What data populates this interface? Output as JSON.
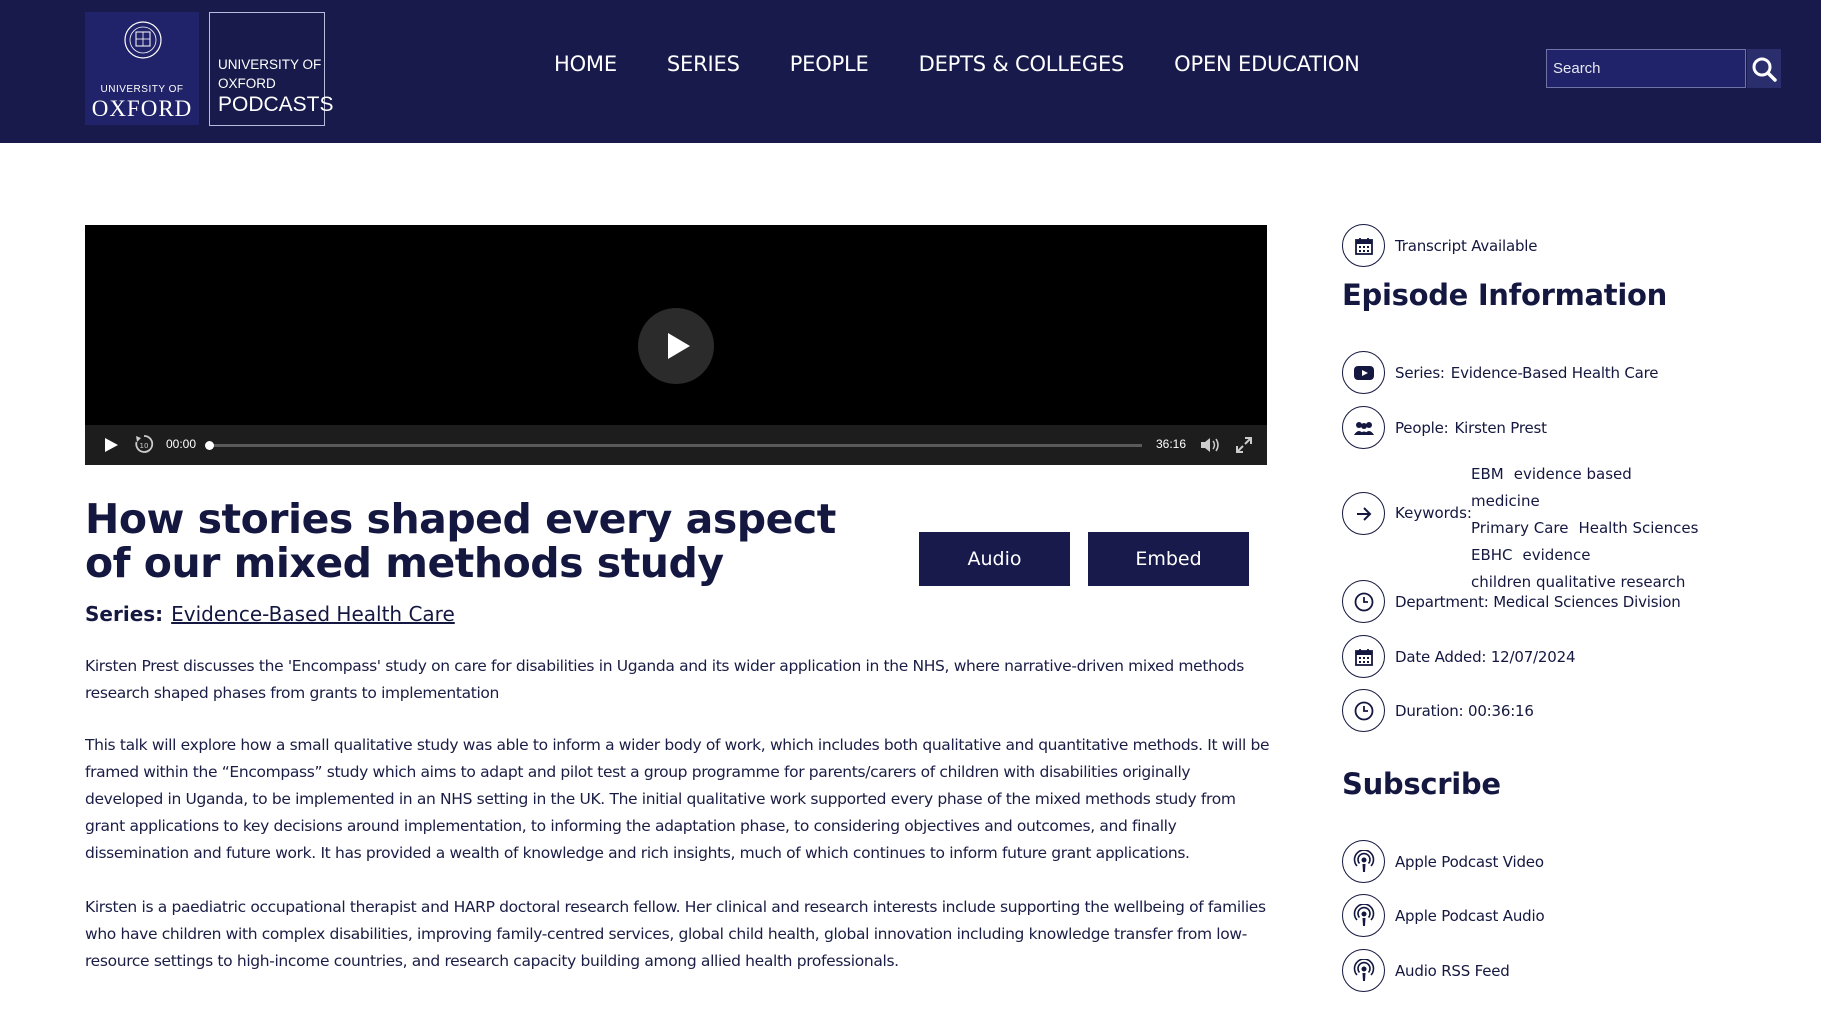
{
  "header": {
    "oxford_small": "UNIVERSITY OF",
    "oxford_big": "OXFORD",
    "podcasts_line1": "UNIVERSITY OF",
    "podcasts_line2": "OXFORD",
    "podcasts_line3": "PODCASTS",
    "nav": [
      "HOME",
      "SERIES",
      "PEOPLE",
      "DEPTS & COLLEGES",
      "OPEN EDUCATION"
    ],
    "search_placeholder": "Search"
  },
  "player": {
    "current_time": "00:00",
    "duration": "36:16",
    "progress": 0
  },
  "episode": {
    "title": "How stories shaped every aspect of our mixed methods study",
    "audio_button": "Audio",
    "embed_button": "Embed",
    "series_label": "Series:",
    "series_name": "Evidence-Based Health Care",
    "paragraphs": [
      "Kirsten Prest discusses the 'Encompass' study on care for disabilities in Uganda and its wider application in the NHS, where narrative-driven mixed methods research shaped phases from grants to implementation",
      "This talk will explore how a small qualitative study was able to inform a wider body of work, which includes both qualitative and quantitative methods. It will be framed within the “Encompass” study which aims to adapt and pilot test a group programme for parents/carers of children with disabilities originally developed in Uganda, to be implemented in an NHS setting in the UK. The initial qualitative work supported every phase of the mixed methods study from grant applications to key decisions around implementation, to informing the adaptation phase, to considering objectives and outcomes, and finally dissemination and future work. It has provided a wealth of knowledge and rich insights, much of which continues to inform future grant applications.",
      "Kirsten is a paediatric occupational therapist and HARP doctoral research fellow. Her clinical and research interests include supporting the wellbeing of families who have children with complex disabilities, improving family-centred services, global child health, global innovation including knowledge transfer from low-resource settings to high-income countries, and research capacity building among allied health professionals."
    ]
  },
  "sidebar": {
    "transcript": "Transcript Available",
    "info_heading": "Episode Information",
    "series_label": "Series:",
    "series_value": "Evidence-Based Health Care",
    "people_label": "People:",
    "people_value": "Kirsten Prest",
    "keywords_label": "Keywords:",
    "keywords": [
      "EBM",
      "evidence based medicine",
      "Primary Care",
      "Health Sciences",
      "EBHC",
      "evidence",
      "children qualitative research"
    ],
    "department": "Department: Medical Sciences Division",
    "date_added": "Date Added: 12/07/2024",
    "duration": "Duration: 00:36:16",
    "subscribe_heading": "Subscribe",
    "subscribe_items": [
      "Apple Podcast Video",
      "Apple Podcast Audio",
      "Audio RSS Feed"
    ]
  },
  "icons": {
    "transcript": "calendar-icon",
    "series": "youtube-icon",
    "people": "people-icon",
    "keywords": "arrow-right-icon",
    "department": "clock-icon",
    "date": "calendar-icon",
    "duration": "clock-icon",
    "subscribe": "podcast-icon"
  },
  "colors": {
    "brand_navy": "#171a4b",
    "text_navy": "#14173f",
    "player_black": "#000000"
  }
}
